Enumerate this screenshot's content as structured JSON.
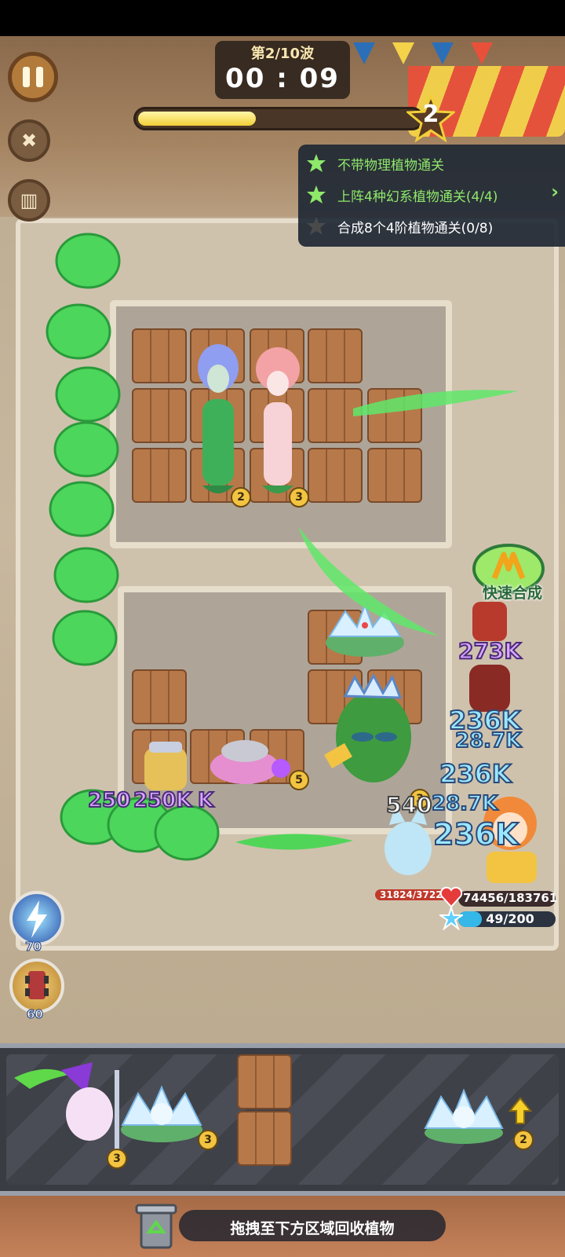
{
  "hud": {
    "wave_label": "第2/10波",
    "timer": "00 : 09",
    "wave_progress": 0.42,
    "star_level": "2"
  },
  "quests": [
    {
      "text": "不带物理植物通关",
      "done": true,
      "color": "#8ee86a"
    },
    {
      "text": "上阵4种幻系植物通关(4/4)",
      "done": true,
      "color": "#8ee86a"
    },
    {
      "text": "合成8个4阶植物通关(0/8)",
      "done": false,
      "color": "#ffffff"
    }
  ],
  "battle": {
    "damage_numbers": [
      "273K",
      "236K",
      "28.7K",
      "236K",
      "28.7K",
      "236K",
      "540"
    ],
    "combo_numbers": [
      "250",
      "250K",
      "K"
    ],
    "board_levels": [
      "2",
      "3",
      "3",
      "5"
    ]
  },
  "quick_merge": {
    "label": "快速合成"
  },
  "player": {
    "hp_text": "74456/183761",
    "energy_text": "49/200",
    "energy_fraction": 0.245,
    "enemy_hp_text": "31824/37224"
  },
  "skills": [
    {
      "icon": "lightning-icon",
      "cost": "70"
    },
    {
      "icon": "truck-icon",
      "cost": "60"
    }
  ],
  "tray": {
    "levels": [
      "3",
      "3",
      "2"
    ]
  },
  "recycle": {
    "label": "拖拽至下方区域回收植物"
  },
  "colors": {
    "accent_gold": "#f2cf37",
    "quest_done": "#8ee86a",
    "damage_blue": "#9be7ff"
  }
}
